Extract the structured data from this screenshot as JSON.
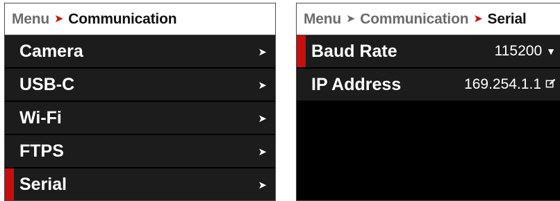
{
  "left_panel": {
    "breadcrumb": {
      "root": "Menu",
      "current": "Communication"
    },
    "items": [
      {
        "label": "Camera",
        "selected": false
      },
      {
        "label": "USB-C",
        "selected": false
      },
      {
        "label": "Wi-Fi",
        "selected": false
      },
      {
        "label": "FTPS",
        "selected": false
      },
      {
        "label": "Serial",
        "selected": true
      }
    ]
  },
  "right_panel": {
    "breadcrumb": {
      "root": "Menu",
      "parent": "Communication",
      "current": "Serial"
    },
    "settings": [
      {
        "label": "Baud Rate",
        "value": "115200",
        "control": "dropdown",
        "selected": true
      },
      {
        "label": "IP Address",
        "value": "169.254.1.1",
        "control": "edit",
        "selected": false
      }
    ]
  },
  "colors": {
    "accent": "#cc0d0d",
    "row_bg": "#1c1c1c",
    "panel_bg": "#000000",
    "breadcrumb_bg": "#ffffff"
  },
  "icons": {
    "chevron": "chevron-right-icon",
    "dropdown": "chevron-down-icon",
    "edit": "edit-icon"
  }
}
